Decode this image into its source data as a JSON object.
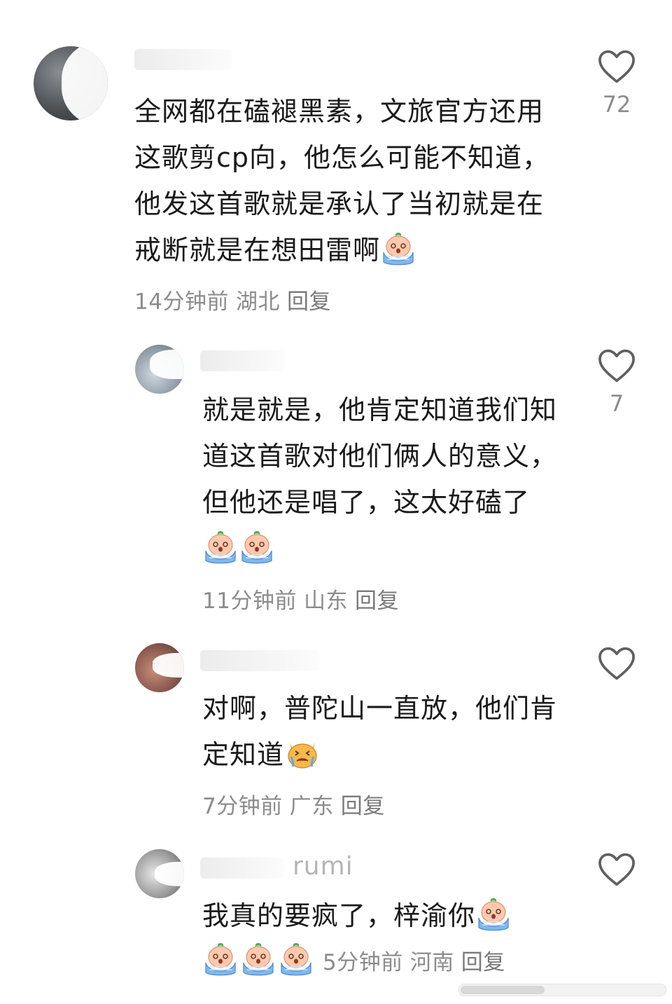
{
  "comments": [
    {
      "text": "全网都在磕褪黑素，文旅官方还用这歌剪cp向，他怎么可能不知道，他发这首歌就是承认了当初就是在戒断就是在想田雷啊",
      "time": "14分钟前",
      "location": "湖北",
      "reply": "回复",
      "likes": "72",
      "emoji": "crying-baby"
    },
    {
      "text": "就是就是，他肯定知道我们知道这首歌对他们俩人的意义，但他还是唱了，这太好磕了",
      "time": "11分钟前",
      "location": "山东",
      "reply": "回复",
      "likes": "7",
      "emoji": "crying-baby"
    },
    {
      "text": "对啊，普陀山一直放，他们肯定知道",
      "time": "7分钟前",
      "location": "广东",
      "reply": "回复",
      "likes": "",
      "emoji": "crying-cat"
    },
    {
      "name_partial": "rumi",
      "text": "我真的要疯了，梓渝你",
      "time": "5分钟前",
      "location": "河南",
      "reply": "回复",
      "likes": "",
      "emoji": "crying-baby"
    }
  ],
  "icons": {
    "like": "heart-outline-icon"
  },
  "colors": {
    "meta": "#8c8c8c",
    "text": "#1a1a1a",
    "heart": "#5f5f5f"
  }
}
